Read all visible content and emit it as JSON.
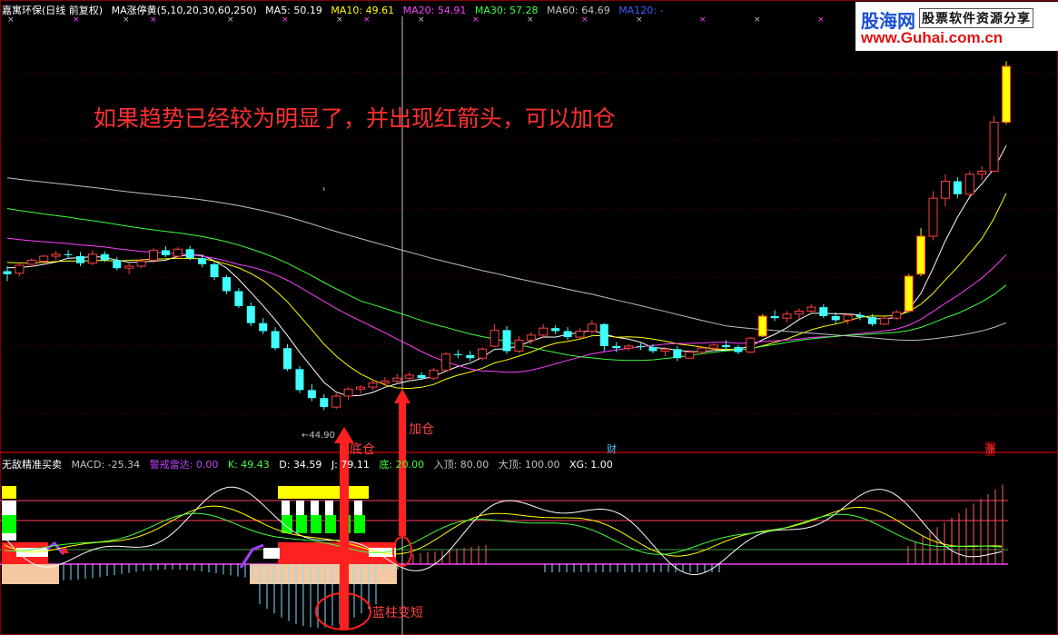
{
  "header": {
    "title": "嘉寓环保(日线 前复权)",
    "indicator": "MA涨停黄(5,10,20,30,60,250)",
    "ma": [
      {
        "label": "MA5: 50.19",
        "color": "#ffffff"
      },
      {
        "label": "MA10: 49.61",
        "color": "#ffff00"
      },
      {
        "label": "MA20: 54.91",
        "color": "#ff40ff"
      },
      {
        "label": "MA30: 57.28",
        "color": "#40ff40"
      },
      {
        "label": "MA60: 64.69",
        "color": "#c0c0c0"
      },
      {
        "label": "MA120: -",
        "color": "#4060ff"
      }
    ]
  },
  "logo": {
    "name": "股海网",
    "tagline": "股票软件资源分享",
    "url": "www.Guhai.com.cn"
  },
  "annotation": "如果趋势已经较为明显了，并出现红箭头，可以加仓",
  "labels": {
    "low_price": "←44.90",
    "bottom_position": "底仓",
    "add_position": "加仓",
    "blue_bar_shorter": "蓝柱变短",
    "cai_marker": "财",
    "zhang_marker": "涨"
  },
  "sub_header": {
    "name": "无敌精准买卖",
    "items": [
      {
        "label": "MACD: -25.34",
        "color": "#c0c0c0"
      },
      {
        "label": "警戒雷达: 0.00",
        "color": "#c040ff"
      },
      {
        "label": "K: 49.43",
        "color": "#40ff40"
      },
      {
        "label": "D: 34.59",
        "color": "#ffffff"
      },
      {
        "label": "J: 79.11",
        "color": "#ffffff"
      },
      {
        "label": "底: 20.00",
        "color": "#40ff40"
      },
      {
        "label": "入顶: 80.00",
        "color": "#c0c0c0"
      },
      {
        "label": "大顶: 100.00",
        "color": "#c0c0c0"
      },
      {
        "label": "XG: 1.00",
        "color": "#ffffff"
      }
    ]
  },
  "colors": {
    "up": "#ff4040",
    "down": "#40ffff",
    "limit_up": "#ffff00",
    "annotation": "#ff3030"
  },
  "chart_data": {
    "type": "candlestick",
    "candles": [
      [
        36.5,
        37.0,
        35.5,
        36.2
      ],
      [
        36.3,
        37.4,
        36.0,
        37.1
      ],
      [
        37.2,
        37.8,
        36.9,
        37.6
      ],
      [
        37.5,
        38.1,
        37.2,
        38.0
      ],
      [
        38.0,
        38.5,
        37.6,
        38.2
      ],
      [
        38.2,
        38.6,
        37.8,
        38.1
      ],
      [
        38.0,
        38.4,
        37.0,
        37.3
      ],
      [
        37.3,
        38.6,
        37.1,
        38.2
      ],
      [
        38.2,
        38.5,
        37.4,
        37.6
      ],
      [
        37.6,
        37.9,
        36.6,
        36.8
      ],
      [
        36.8,
        37.3,
        36.2,
        37.0
      ],
      [
        37.0,
        37.8,
        36.8,
        37.5
      ],
      [
        37.6,
        38.8,
        37.3,
        38.6
      ],
      [
        38.6,
        39.0,
        37.9,
        38.1
      ],
      [
        38.0,
        38.9,
        37.8,
        38.7
      ],
      [
        38.7,
        39.0,
        37.6,
        37.8
      ],
      [
        37.8,
        38.1,
        36.9,
        37.2
      ],
      [
        37.2,
        37.5,
        35.6,
        35.9
      ],
      [
        35.9,
        36.1,
        34.2,
        34.5
      ],
      [
        34.5,
        34.8,
        32.8,
        33.0
      ],
      [
        33.0,
        33.4,
        31.0,
        31.3
      ],
      [
        31.3,
        31.8,
        30.2,
        30.5
      ],
      [
        30.5,
        30.9,
        28.6,
        28.8
      ],
      [
        28.8,
        29.2,
        26.5,
        26.7
      ],
      [
        26.7,
        27.0,
        24.3,
        24.6
      ],
      [
        24.6,
        25.2,
        23.5,
        23.8
      ],
      [
        23.8,
        24.2,
        22.6,
        22.9
      ],
      [
        22.9,
        24.3,
        22.7,
        24.0
      ],
      [
        24.0,
        24.9,
        23.6,
        24.7
      ],
      [
        24.7,
        25.1,
        24.2,
        24.9
      ],
      [
        24.9,
        25.6,
        24.6,
        25.3
      ],
      [
        25.3,
        25.9,
        25.0,
        25.5
      ],
      [
        25.5,
        26.2,
        25.2,
        25.8
      ],
      [
        25.8,
        26.4,
        25.5,
        26.1
      ],
      [
        26.1,
        26.4,
        25.6,
        25.8
      ],
      [
        25.8,
        26.8,
        25.6,
        26.6
      ],
      [
        26.6,
        28.4,
        26.4,
        28.2
      ],
      [
        28.2,
        28.6,
        27.8,
        28.1
      ],
      [
        28.1,
        28.5,
        27.5,
        27.8
      ],
      [
        27.8,
        28.9,
        27.6,
        28.7
      ],
      [
        29.0,
        31.2,
        28.9,
        30.6
      ],
      [
        30.6,
        31.0,
        28.2,
        28.5
      ],
      [
        28.5,
        30.0,
        28.3,
        29.6
      ],
      [
        29.6,
        30.4,
        29.2,
        30.1
      ],
      [
        30.1,
        31.2,
        29.8,
        30.8
      ],
      [
        30.8,
        31.1,
        30.2,
        30.5
      ],
      [
        30.5,
        30.9,
        29.6,
        29.9
      ],
      [
        29.9,
        30.8,
        29.7,
        30.5
      ],
      [
        30.5,
        31.6,
        30.2,
        31.2
      ],
      [
        31.2,
        31.3,
        28.5,
        29.0
      ],
      [
        29.0,
        29.4,
        28.4,
        28.8
      ],
      [
        28.8,
        29.2,
        28.5,
        29.0
      ],
      [
        29.0,
        29.3,
        28.6,
        28.9
      ],
      [
        28.9,
        29.2,
        28.3,
        28.5
      ],
      [
        28.5,
        28.9,
        28.0,
        28.7
      ],
      [
        28.7,
        29.0,
        27.5,
        27.8
      ],
      [
        27.8,
        28.6,
        27.7,
        28.4
      ],
      [
        28.4,
        29.0,
        28.2,
        28.8
      ],
      [
        28.8,
        29.3,
        28.5,
        29.1
      ],
      [
        29.1,
        29.6,
        28.6,
        28.9
      ],
      [
        28.9,
        29.1,
        28.2,
        28.4
      ],
      [
        28.4,
        29.9,
        28.3,
        29.8
      ],
      [
        30.0,
        32.2,
        29.9,
        32.0
      ],
      [
        32.0,
        32.6,
        31.5,
        31.8
      ],
      [
        31.8,
        32.5,
        31.4,
        32.2
      ],
      [
        32.2,
        32.8,
        31.7,
        32.5
      ],
      [
        32.5,
        33.2,
        32.2,
        32.9
      ],
      [
        32.9,
        33.2,
        31.8,
        32.0
      ],
      [
        32.0,
        32.4,
        31.2,
        31.6
      ],
      [
        31.6,
        32.3,
        31.2,
        32.1
      ],
      [
        32.1,
        32.4,
        31.6,
        31.9
      ],
      [
        31.9,
        32.2,
        31.0,
        31.2
      ],
      [
        31.2,
        32.0,
        31.1,
        31.8
      ],
      [
        31.8,
        32.6,
        31.6,
        32.4
      ],
      [
        32.5,
        36.2,
        32.4,
        36.0
      ],
      [
        36.2,
        40.8,
        36.0,
        40.0
      ],
      [
        40.0,
        44.5,
        39.6,
        43.8
      ],
      [
        43.8,
        46.2,
        43.0,
        45.5
      ],
      [
        45.5,
        45.9,
        43.8,
        44.2
      ],
      [
        44.2,
        46.5,
        44.0,
        46.2
      ],
      [
        46.2,
        47.0,
        45.6,
        46.5
      ],
      [
        46.5,
        52.0,
        46.4,
        51.4
      ],
      [
        51.4,
        57.5,
        51.2,
        57.0
      ]
    ],
    "low_marker": 44.9,
    "limit_up_days": [
      62,
      74,
      75,
      82,
      83
    ]
  }
}
